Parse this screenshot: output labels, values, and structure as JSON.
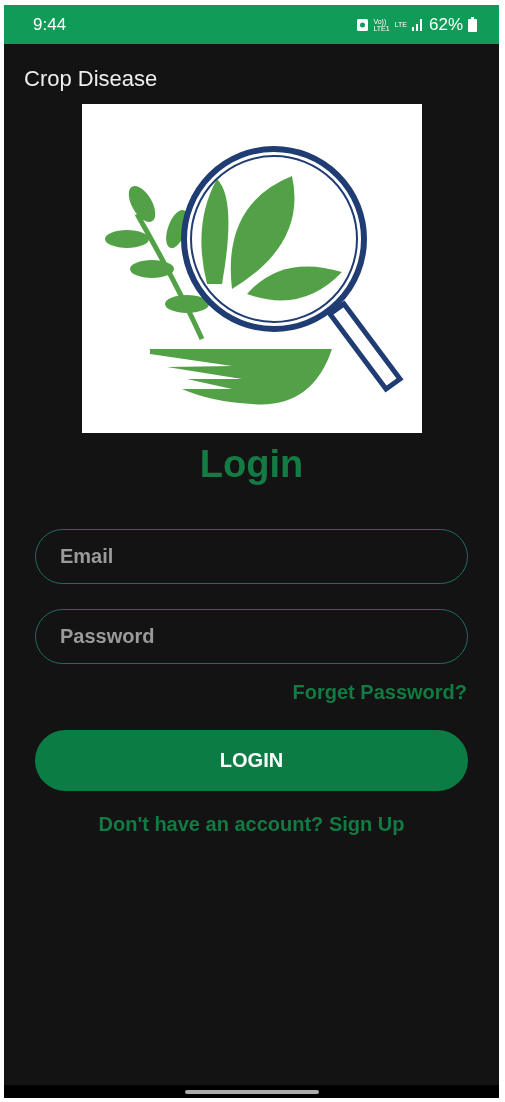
{
  "status_bar": {
    "time": "9:44",
    "volte": [
      "Vo))",
      "LTE1"
    ],
    "network": "LTE",
    "battery": "62%"
  },
  "app_bar": {
    "title": "Crop Disease"
  },
  "heading": "Login",
  "fields": [
    {
      "placeholder": "Email"
    },
    {
      "placeholder": "Password"
    }
  ],
  "forgot_link": "Forget Password?",
  "login_button": "LOGIN",
  "signup_link": "Don't have an account? Sign Up"
}
